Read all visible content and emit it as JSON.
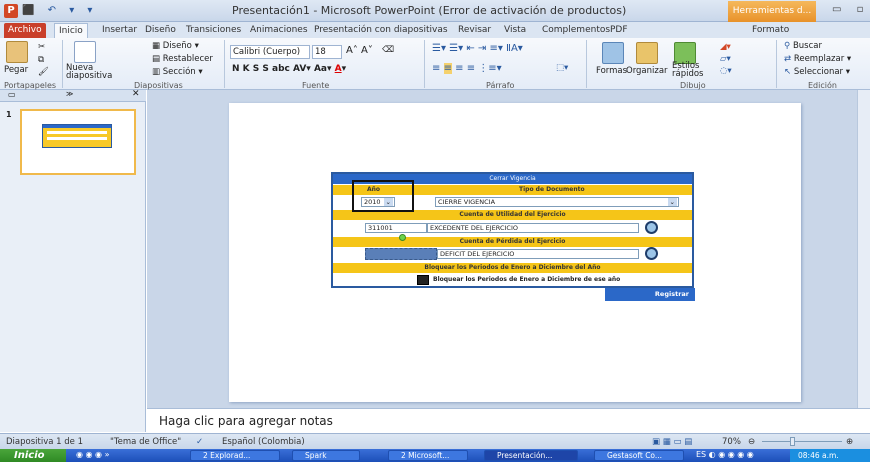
{
  "titlebar": {
    "app_icon": "P",
    "quick_access": "⬛ ↶ ▾ ▾",
    "title": "Presentación1 - Microsoft PowerPoint (Error de activación de productos)",
    "contextual": "Herramientas d..."
  },
  "tabs": [
    "Archivo",
    "Inicio",
    "Insertar",
    "Diseño",
    "Transiciones",
    "Animaciones",
    "Presentación con diapositivas",
    "Revisar",
    "Vista",
    "Complementos",
    "PDF",
    "Formato"
  ],
  "ribbon": {
    "paste": "Pegar",
    "new_slide": "Nueva\ndiapositiva",
    "layout": "Diseño",
    "reset": "Restablecer",
    "section": "Sección",
    "font_name": "Calibri (Cuerpo)",
    "font_size": "18",
    "arrange": "Organizar",
    "shapes": "Formas",
    "quick_styles": "Estilos rápidos",
    "find": "Buscar",
    "replace": "Reemplazar",
    "select": "Seleccionar",
    "groups": [
      "Portapapeles",
      "Diapositivas",
      "Fuente",
      "Párrafo",
      "Dibujo",
      "Edición"
    ]
  },
  "slide_panel": {
    "slide_number": "1"
  },
  "form": {
    "header": "Cerrar Vigencia",
    "year_label": "Año",
    "doc_type_label": "Tipo de Documento",
    "year_value": "2010",
    "doc_type_value": "CIERRE VIGENCIA",
    "profit_account_label": "Cuenta de Utilidad del Ejercicio",
    "profit_account_code": "311001",
    "profit_account_name": "EXCEDENTE DEL EJERCICIO",
    "loss_account_label": "Cuenta de Pérdida del Ejercicio",
    "loss_account_name": "DEFICIT DEL EJERCICIO",
    "lock_periods_bar": "Bloquear los Periodos de Enero a Diciembre del Año",
    "lock_periods_check": "Bloquear los Periodos de Enero a Diciembre de ese año",
    "register_button": "Registrar"
  },
  "notes": "Haga clic para agregar notas",
  "statusbar": {
    "slide_info": "Diapositiva 1 de 1",
    "theme": "\"Tema de Office\"",
    "language": "Español (Colombia)",
    "zoom": "70%"
  },
  "taskbar": {
    "start": "Inicio",
    "tasks": [
      "2 Explorad...",
      "Spark",
      "2 Microsoft...",
      "Presentación...",
      "Gestasoft Co..."
    ],
    "clock": "08:46 a.m."
  },
  "colors": {
    "ppt_red": "#d24726",
    "form_blue": "#2b68c8",
    "form_yellow": "#f5c518",
    "ribbon_bg": "#e4ecf7",
    "taskbar_blue": "#2456c4"
  }
}
